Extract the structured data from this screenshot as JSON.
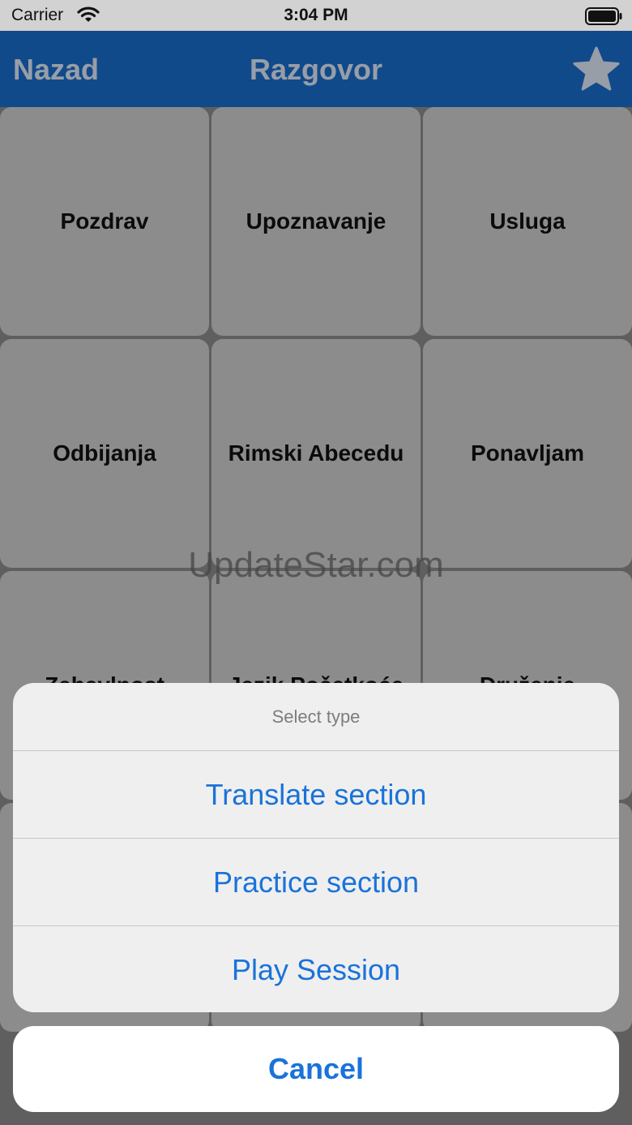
{
  "status_bar": {
    "carrier": "Carrier",
    "time": "3:04 PM"
  },
  "nav": {
    "back_label": "Nazad",
    "title": "Razgovor",
    "favorite_icon": "star-icon",
    "color": "#1a6ecd"
  },
  "grid": {
    "tiles": [
      "Pozdrav",
      "Upoznavanje",
      "Usluga",
      "Odbijanja",
      "Rimski Abecedu",
      "Ponavljam",
      "Zabavlnost",
      "Jezik Početkoće",
      "Druženje"
    ]
  },
  "watermark": "UpdateStar.com",
  "action_sheet": {
    "header": "Select type",
    "actions": [
      "Translate section",
      "Practice section",
      "Play Session"
    ],
    "cancel": "Cancel",
    "accent": "#1a73d9"
  }
}
